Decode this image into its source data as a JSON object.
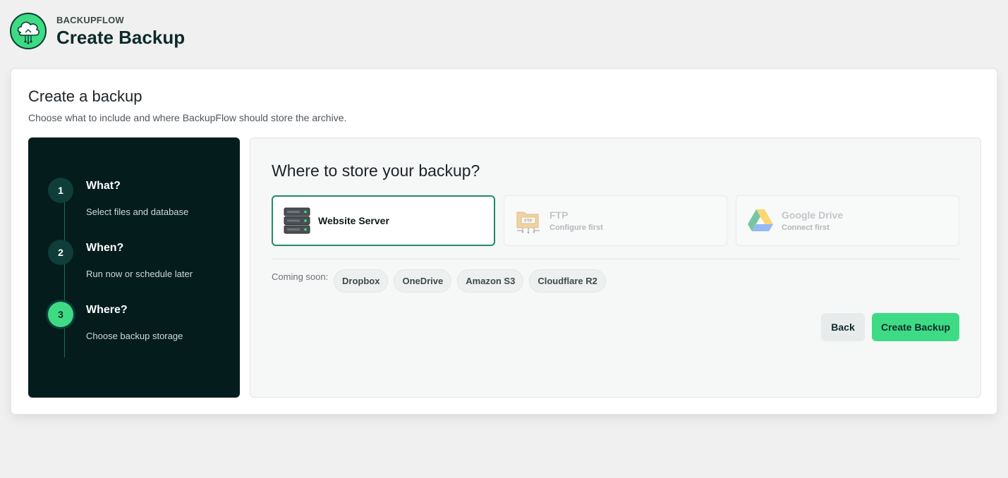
{
  "app": {
    "brand": "BACKUPFLOW",
    "title": "Create Backup"
  },
  "card": {
    "title": "Create a backup",
    "subtitle": "Choose what to include and where BackupFlow should store the archive."
  },
  "steps": [
    {
      "num": "1",
      "title": "What?",
      "desc": "Select files and database",
      "active": false
    },
    {
      "num": "2",
      "title": "When?",
      "desc": "Run now or schedule later",
      "active": false
    },
    {
      "num": "3",
      "title": "Where?",
      "desc": "Choose backup storage",
      "active": true
    }
  ],
  "panel": {
    "title": "Where to store your backup?",
    "options": [
      {
        "label": "Website Server",
        "sub": "",
        "icon": "server-icon",
        "state": "selected"
      },
      {
        "label": "FTP",
        "sub": "Configure first",
        "icon": "ftp-folder-icon",
        "state": "disabled"
      },
      {
        "label": "Google Drive",
        "sub": "Connect first",
        "icon": "google-drive-icon",
        "state": "disabled"
      }
    ],
    "coming_soon_label": "Coming soon:",
    "coming_soon": [
      "Dropbox",
      "OneDrive",
      "Amazon S3",
      "Cloudflare R2"
    ],
    "back_label": "Back",
    "create_label": "Create Backup"
  },
  "colors": {
    "accent": "#3ddc84",
    "dark": "#041c1c",
    "selected_border": "#1f8a68"
  }
}
